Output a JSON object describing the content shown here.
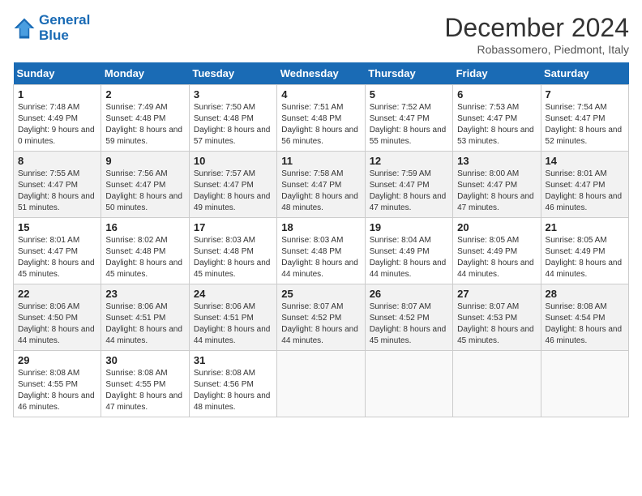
{
  "header": {
    "logo_line1": "General",
    "logo_line2": "Blue",
    "title": "December 2024",
    "subtitle": "Robassomero, Piedmont, Italy"
  },
  "calendar": {
    "days_of_week": [
      "Sunday",
      "Monday",
      "Tuesday",
      "Wednesday",
      "Thursday",
      "Friday",
      "Saturday"
    ],
    "weeks": [
      [
        null,
        {
          "day": "2",
          "sunrise": "Sunrise: 7:49 AM",
          "sunset": "Sunset: 4:48 PM",
          "daylight": "Daylight: 8 hours and 59 minutes."
        },
        {
          "day": "3",
          "sunrise": "Sunrise: 7:50 AM",
          "sunset": "Sunset: 4:48 PM",
          "daylight": "Daylight: 8 hours and 57 minutes."
        },
        {
          "day": "4",
          "sunrise": "Sunrise: 7:51 AM",
          "sunset": "Sunset: 4:48 PM",
          "daylight": "Daylight: 8 hours and 56 minutes."
        },
        {
          "day": "5",
          "sunrise": "Sunrise: 7:52 AM",
          "sunset": "Sunset: 4:47 PM",
          "daylight": "Daylight: 8 hours and 55 minutes."
        },
        {
          "day": "6",
          "sunrise": "Sunrise: 7:53 AM",
          "sunset": "Sunset: 4:47 PM",
          "daylight": "Daylight: 8 hours and 53 minutes."
        },
        {
          "day": "7",
          "sunrise": "Sunrise: 7:54 AM",
          "sunset": "Sunset: 4:47 PM",
          "daylight": "Daylight: 8 hours and 52 minutes."
        }
      ],
      [
        {
          "day": "1",
          "sunrise": "Sunrise: 7:48 AM",
          "sunset": "Sunset: 4:49 PM",
          "daylight": "Daylight: 9 hours and 0 minutes."
        },
        {
          "day": "9",
          "sunrise": "Sunrise: 7:56 AM",
          "sunset": "Sunset: 4:47 PM",
          "daylight": "Daylight: 8 hours and 50 minutes."
        },
        {
          "day": "10",
          "sunrise": "Sunrise: 7:57 AM",
          "sunset": "Sunset: 4:47 PM",
          "daylight": "Daylight: 8 hours and 49 minutes."
        },
        {
          "day": "11",
          "sunrise": "Sunrise: 7:58 AM",
          "sunset": "Sunset: 4:47 PM",
          "daylight": "Daylight: 8 hours and 48 minutes."
        },
        {
          "day": "12",
          "sunrise": "Sunrise: 7:59 AM",
          "sunset": "Sunset: 4:47 PM",
          "daylight": "Daylight: 8 hours and 47 minutes."
        },
        {
          "day": "13",
          "sunrise": "Sunrise: 8:00 AM",
          "sunset": "Sunset: 4:47 PM",
          "daylight": "Daylight: 8 hours and 47 minutes."
        },
        {
          "day": "14",
          "sunrise": "Sunrise: 8:01 AM",
          "sunset": "Sunset: 4:47 PM",
          "daylight": "Daylight: 8 hours and 46 minutes."
        }
      ],
      [
        {
          "day": "8",
          "sunrise": "Sunrise: 7:55 AM",
          "sunset": "Sunset: 4:47 PM",
          "daylight": "Daylight: 8 hours and 51 minutes."
        },
        {
          "day": "16",
          "sunrise": "Sunrise: 8:02 AM",
          "sunset": "Sunset: 4:48 PM",
          "daylight": "Daylight: 8 hours and 45 minutes."
        },
        {
          "day": "17",
          "sunrise": "Sunrise: 8:03 AM",
          "sunset": "Sunset: 4:48 PM",
          "daylight": "Daylight: 8 hours and 45 minutes."
        },
        {
          "day": "18",
          "sunrise": "Sunrise: 8:03 AM",
          "sunset": "Sunset: 4:48 PM",
          "daylight": "Daylight: 8 hours and 44 minutes."
        },
        {
          "day": "19",
          "sunrise": "Sunrise: 8:04 AM",
          "sunset": "Sunset: 4:49 PM",
          "daylight": "Daylight: 8 hours and 44 minutes."
        },
        {
          "day": "20",
          "sunrise": "Sunrise: 8:05 AM",
          "sunset": "Sunset: 4:49 PM",
          "daylight": "Daylight: 8 hours and 44 minutes."
        },
        {
          "day": "21",
          "sunrise": "Sunrise: 8:05 AM",
          "sunset": "Sunset: 4:49 PM",
          "daylight": "Daylight: 8 hours and 44 minutes."
        }
      ],
      [
        {
          "day": "15",
          "sunrise": "Sunrise: 8:01 AM",
          "sunset": "Sunset: 4:47 PM",
          "daylight": "Daylight: 8 hours and 45 minutes."
        },
        {
          "day": "23",
          "sunrise": "Sunrise: 8:06 AM",
          "sunset": "Sunset: 4:51 PM",
          "daylight": "Daylight: 8 hours and 44 minutes."
        },
        {
          "day": "24",
          "sunrise": "Sunrise: 8:06 AM",
          "sunset": "Sunset: 4:51 PM",
          "daylight": "Daylight: 8 hours and 44 minutes."
        },
        {
          "day": "25",
          "sunrise": "Sunrise: 8:07 AM",
          "sunset": "Sunset: 4:52 PM",
          "daylight": "Daylight: 8 hours and 44 minutes."
        },
        {
          "day": "26",
          "sunrise": "Sunrise: 8:07 AM",
          "sunset": "Sunset: 4:52 PM",
          "daylight": "Daylight: 8 hours and 45 minutes."
        },
        {
          "day": "27",
          "sunrise": "Sunrise: 8:07 AM",
          "sunset": "Sunset: 4:53 PM",
          "daylight": "Daylight: 8 hours and 45 minutes."
        },
        {
          "day": "28",
          "sunrise": "Sunrise: 8:08 AM",
          "sunset": "Sunset: 4:54 PM",
          "daylight": "Daylight: 8 hours and 46 minutes."
        }
      ],
      [
        {
          "day": "22",
          "sunrise": "Sunrise: 8:06 AM",
          "sunset": "Sunset: 4:50 PM",
          "daylight": "Daylight: 8 hours and 44 minutes."
        },
        {
          "day": "30",
          "sunrise": "Sunrise: 8:08 AM",
          "sunset": "Sunset: 4:55 PM",
          "daylight": "Daylight: 8 hours and 47 minutes."
        },
        {
          "day": "31",
          "sunrise": "Sunrise: 8:08 AM",
          "sunset": "Sunset: 4:56 PM",
          "daylight": "Daylight: 8 hours and 48 minutes."
        },
        null,
        null,
        null,
        null
      ],
      [
        {
          "day": "29",
          "sunrise": "Sunrise: 8:08 AM",
          "sunset": "Sunset: 4:55 PM",
          "daylight": "Daylight: 8 hours and 46 minutes."
        },
        null,
        null,
        null,
        null,
        null,
        null
      ]
    ]
  }
}
